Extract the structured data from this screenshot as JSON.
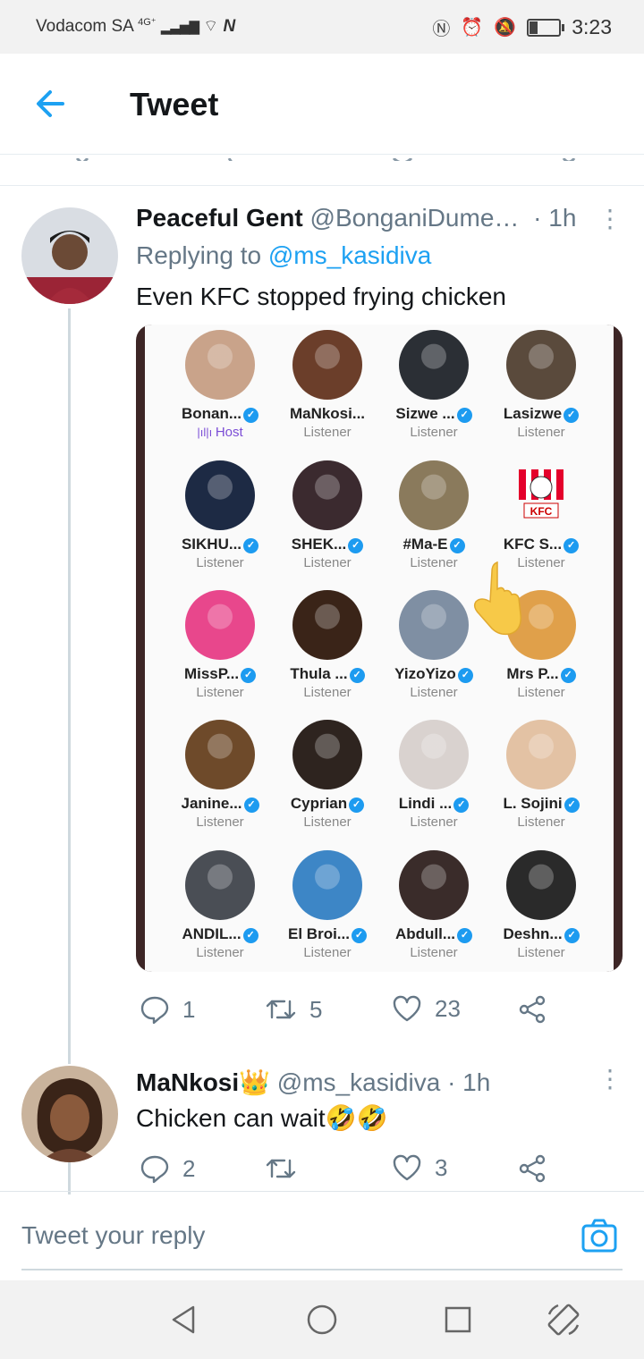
{
  "status_bar": {
    "carrier": "Vodacom SA",
    "network": "4G⁺",
    "time": "3:23",
    "battery_level": 0.3
  },
  "header": {
    "title": "Tweet",
    "back_icon": "arrow-left-icon"
  },
  "tweets": [
    {
      "name": "Peaceful Gent",
      "handle": "@BonganiDume…",
      "time": "· 1h",
      "replying_label": "Replying to",
      "replying_to": "@ms_kasidiva",
      "text": "Even KFC stopped frying chicken",
      "stats": {
        "replies": "1",
        "retweets": "5",
        "likes": "23"
      }
    },
    {
      "name": "MaNkosi👑",
      "handle": "@ms_kasidiva",
      "time": "· 1h",
      "text": "Chicken can wait🤣🤣",
      "stats": {
        "replies": "2",
        "retweets": "",
        "likes": "3"
      }
    }
  ],
  "embedded_image": {
    "participants": [
      {
        "name": "Bonan...",
        "role": "Host",
        "verified": true,
        "color": "#c9a38a"
      },
      {
        "name": "MaNkosi...",
        "role": "Listener",
        "verified": false,
        "color": "#6b3e2a"
      },
      {
        "name": "Sizwe ...",
        "role": "Listener",
        "verified": true,
        "color": "#2b2f35"
      },
      {
        "name": "Lasizwe",
        "role": "Listener",
        "verified": true,
        "color": "#5a4a3c"
      },
      {
        "name": "SIKHU...",
        "role": "Listener",
        "verified": true,
        "color": "#1d2a44"
      },
      {
        "name": "SHEK...",
        "role": "Listener",
        "verified": true,
        "color": "#3b2a2f"
      },
      {
        "name": "#Ma-E",
        "role": "Listener",
        "verified": true,
        "color": "#8a7a5c"
      },
      {
        "name": "KFC S...",
        "role": "Listener",
        "verified": true,
        "color": "#ffffff"
      },
      {
        "name": "MissP...",
        "role": "Listener",
        "verified": true,
        "color": "#e8478c"
      },
      {
        "name": "Thula ...",
        "role": "Listener",
        "verified": true,
        "color": "#3a2418"
      },
      {
        "name": "YizoYizo",
        "role": "Listener",
        "verified": true,
        "color": "#7f8fa3"
      },
      {
        "name": "Mrs P...",
        "role": "Listener",
        "verified": true,
        "color": "#e0a04a"
      },
      {
        "name": "Janine...",
        "role": "Listener",
        "verified": true,
        "color": "#6e4a2a"
      },
      {
        "name": "Cyprian",
        "role": "Listener",
        "verified": true,
        "color": "#2e241f"
      },
      {
        "name": "Lindi ...",
        "role": "Listener",
        "verified": true,
        "color": "#d9d2cf"
      },
      {
        "name": "L. Sojini",
        "role": "Listener",
        "verified": true,
        "color": "#e3c2a4"
      },
      {
        "name": "ANDIL...",
        "role": "Listener",
        "verified": true,
        "color": "#4a4e55"
      },
      {
        "name": "El Broi...",
        "role": "Listener",
        "verified": true,
        "color": "#3d86c6"
      },
      {
        "name": "Abdull...",
        "role": "Listener",
        "verified": true,
        "color": "#3a2c2a"
      },
      {
        "name": "Deshn...",
        "role": "Listener",
        "verified": true,
        "color": "#2a2a2a"
      }
    ]
  },
  "composer": {
    "placeholder": "Tweet your reply",
    "camera_icon": "camera-icon"
  },
  "nav": [
    "back-nav-icon",
    "home-nav-icon",
    "recents-nav-icon",
    "rotate-nav-icon"
  ],
  "colors": {
    "accent": "#1da1f2",
    "muted": "#657786"
  }
}
